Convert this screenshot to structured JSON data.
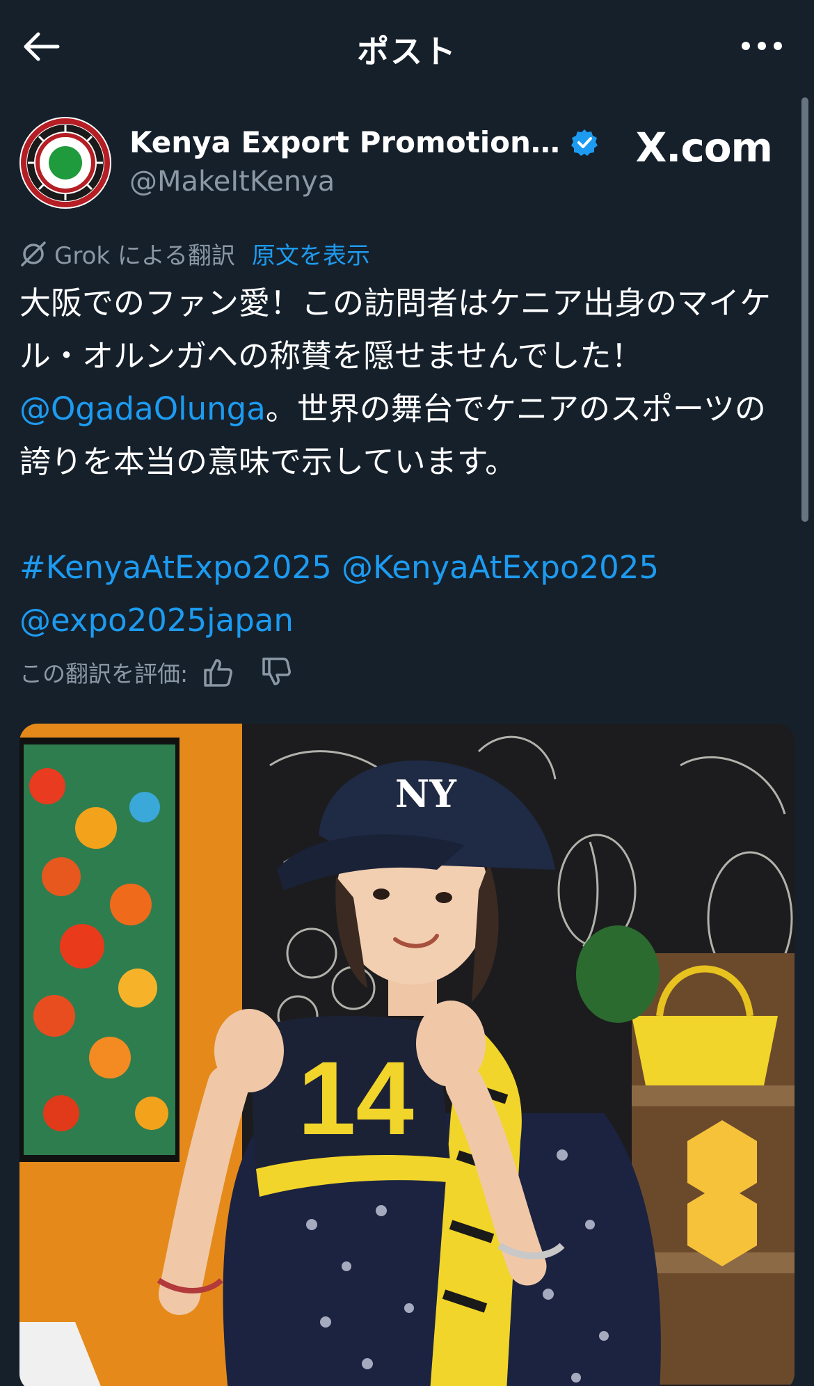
{
  "header": {
    "title": "ポスト",
    "back_icon": "arrow-left-icon",
    "more_icon": "more-horizontal-icon"
  },
  "author": {
    "name": "Kenya Export Promotion…",
    "handle": "@MakeItKenya",
    "verified": true,
    "site_badge": "X.com"
  },
  "translation": {
    "translated_by": "Grok による翻訳",
    "show_original": "原文を表示",
    "rate_label": "この翻訳を評価:"
  },
  "post": {
    "line1": "大阪でのファン愛！この訪問者はケニア出身のマイケル・オルンガへの称賛を隠せませんでした！",
    "mention1": "@OgadaOlunga",
    "line2": "。世界の舞台でケニアのスポーツの誇りを本当の意味で示しています。",
    "hashtag": "#KenyaAtExpo2025",
    "mention2": "@KenyaAtExpo2025",
    "mention3": "@expo2025japan"
  },
  "media": {
    "jersey_number": "14",
    "cap_logo": "NY"
  },
  "colors": {
    "background": "#15202b",
    "accent": "#1d9bf0",
    "muted": "#8b98a5"
  }
}
